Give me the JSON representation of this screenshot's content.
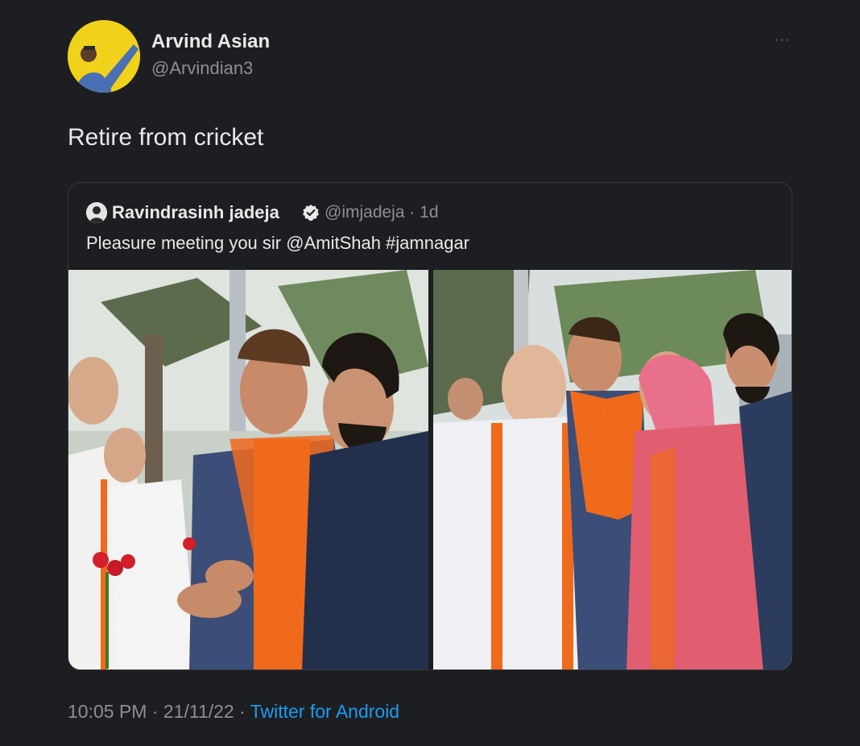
{
  "author": {
    "name": "Arvind Asian",
    "handle": "@Arvindian3"
  },
  "tweet": {
    "text": "Retire from cricket"
  },
  "quoted_tweet": {
    "name": "Ravindrasinh jadeja",
    "handle_time": "@imjadeja · 1d",
    "text": "Pleasure meeting you sir @AmitShah #jamnagar",
    "photos": [
      {
        "alt": "Photo of men greeting with flowers"
      },
      {
        "alt": "Photo of group meeting outdoors"
      }
    ]
  },
  "meta": {
    "time_date": "10:05 PM · 21/11/22 · ",
    "source": "Twitter for Android"
  },
  "icons": {
    "more": "more-options-icon",
    "verified": "verified-badge-icon"
  },
  "colors": {
    "background": "#1d1e21",
    "link": "#1d9bf0",
    "secondary_text": "#8b8f94",
    "saffron": "#f06a1c"
  }
}
